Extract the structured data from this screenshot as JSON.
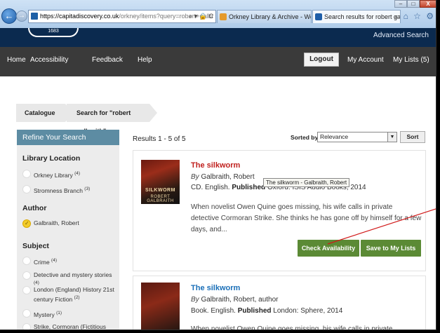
{
  "browser": {
    "url_host": "https://capitadiscovery.co.uk",
    "url_rest": "/orkney/items?query=robert+galbr",
    "address_icons": "⌕ ▾ 🔒 C",
    "tab1_label": "Orkney Library & Archive - We...",
    "tab2_label": "Search results for robert gal...",
    "tab_close": "×",
    "toolbar_icons": "⌂ ☆ ⚙",
    "win_min": "–",
    "win_max": "□",
    "win_close": "X"
  },
  "header": {
    "logo_text": "1683",
    "advanced_search": "Advanced Search"
  },
  "nav": {
    "home": "Home",
    "accessibility": "Accessibility",
    "feedback": "Feedback",
    "help": "Help",
    "logout": "Logout",
    "my_account": "My Account",
    "my_lists": "My Lists (5)"
  },
  "breadcrumb": {
    "catalogue": "Catalogue",
    "search": "Search for \"robert galbraith\""
  },
  "sidebar": {
    "header": "Refine Your Search",
    "library_location": {
      "title": "Library Location",
      "items": [
        {
          "label": "Orkney Library",
          "count": "(4)"
        },
        {
          "label": "Stromness Branch",
          "count": "(3)"
        }
      ]
    },
    "author": {
      "title": "Author",
      "items": [
        {
          "label": "Galbraith, Robert",
          "selected": true
        }
      ]
    },
    "subject": {
      "title": "Subject",
      "items": [
        {
          "label": "Crime",
          "count": "(4)"
        },
        {
          "label": "Detective and mystery stories",
          "count": "(4)"
        },
        {
          "label": "London (England) History 21st century Fiction",
          "count": "(2)"
        },
        {
          "label": "Mystery",
          "count": "(1)"
        },
        {
          "label": "Strike, Cormoran (Fictitious",
          "count": ""
        }
      ]
    }
  },
  "results": {
    "count_text": "Results 1 - 5 of 5",
    "sorted_by_label": "Sorted by",
    "sort_value": "Relevance",
    "sort_button": "Sort",
    "items": [
      {
        "title": "The silkworm",
        "by": "By",
        "author": "Galbraith, Robert",
        "format_pre": "CD. English.",
        "published_label": "Published",
        "published_value": "Oxford: ISIS Audio Books, 2014",
        "description": "When novelist Owen Quine goes missing, his wife calls in private detective Cormoran Strike. She thinks he has gone off by himself for a few days, and...",
        "cover_title": "SILKWORM",
        "cover_author": "ROBERT GALBRAITH",
        "check_availability": "Check Availability",
        "save_to_lists": "Save to My Lists",
        "tooltip": "The silkworm - Galbraith, Robert"
      },
      {
        "title": "The silkworm",
        "by": "By",
        "author": "Galbraith, Robert, author",
        "format_pre": "Book. English.",
        "published_label": "Published",
        "published_value": "London: Sphere, 2014",
        "description": "When novelist Owen Quine goes missing, his wife calls in private detective"
      }
    ]
  },
  "colors": {
    "header_dark": "#0b2a4f",
    "nav_bg": "#3a3a3a",
    "refine_header": "#5d8ca3",
    "button_green": "#5b8a35",
    "title_red": "#c0211e",
    "title_blue": "#1a6fb8",
    "annotation_red": "#d11a1a"
  }
}
